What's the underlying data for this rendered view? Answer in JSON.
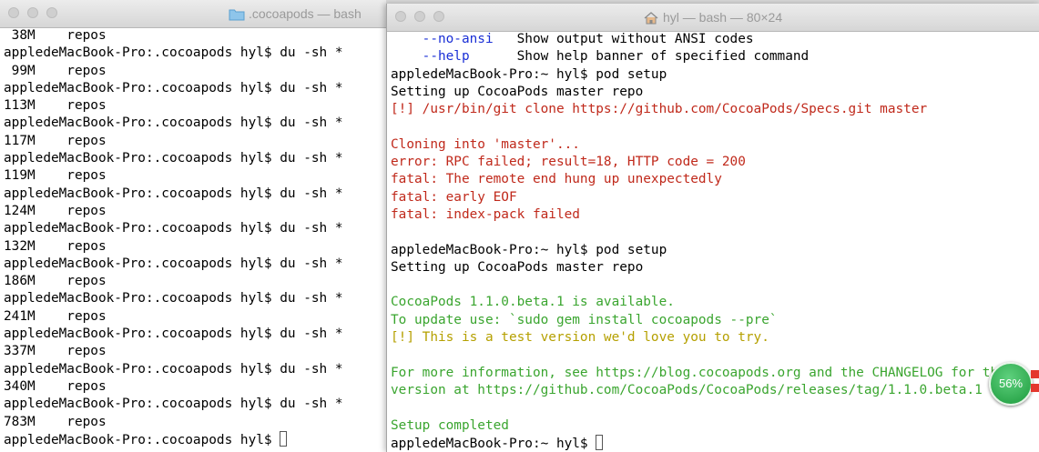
{
  "colors": {
    "default": "#000000",
    "option": "#1a2fd6",
    "error": "#c0291b",
    "success": "#3aa52f",
    "warning": "#b5a000"
  },
  "left_window": {
    "title": ".cocoapods — bash",
    "folder_icon": "folder-icon",
    "lines": [
      {
        "text": " 38M    repos",
        "color": "default"
      },
      {
        "text": "appledeMacBook-Pro:.cocoapods hyl$ du -sh *",
        "color": "default"
      },
      {
        "text": " 99M    repos",
        "color": "default"
      },
      {
        "text": "appledeMacBook-Pro:.cocoapods hyl$ du -sh *",
        "color": "default"
      },
      {
        "text": "113M    repos",
        "color": "default"
      },
      {
        "text": "appledeMacBook-Pro:.cocoapods hyl$ du -sh *",
        "color": "default"
      },
      {
        "text": "117M    repos",
        "color": "default"
      },
      {
        "text": "appledeMacBook-Pro:.cocoapods hyl$ du -sh *",
        "color": "default"
      },
      {
        "text": "119M    repos",
        "color": "default"
      },
      {
        "text": "appledeMacBook-Pro:.cocoapods hyl$ du -sh *",
        "color": "default"
      },
      {
        "text": "124M    repos",
        "color": "default"
      },
      {
        "text": "appledeMacBook-Pro:.cocoapods hyl$ du -sh *",
        "color": "default"
      },
      {
        "text": "132M    repos",
        "color": "default"
      },
      {
        "text": "appledeMacBook-Pro:.cocoapods hyl$ du -sh *",
        "color": "default"
      },
      {
        "text": "186M    repos",
        "color": "default"
      },
      {
        "text": "appledeMacBook-Pro:.cocoapods hyl$ du -sh *",
        "color": "default"
      },
      {
        "text": "241M    repos",
        "color": "default"
      },
      {
        "text": "appledeMacBook-Pro:.cocoapods hyl$ du -sh *",
        "color": "default"
      },
      {
        "text": "337M    repos",
        "color": "default"
      },
      {
        "text": "appledeMacBook-Pro:.cocoapods hyl$ du -sh *",
        "color": "default"
      },
      {
        "text": "340M    repos",
        "color": "default"
      },
      {
        "text": "appledeMacBook-Pro:.cocoapods hyl$ du -sh *",
        "color": "default"
      },
      {
        "text": "783M    repos",
        "color": "default"
      },
      {
        "text": "appledeMacBook-Pro:.cocoapods hyl$ ",
        "color": "default",
        "cursor": true
      }
    ]
  },
  "right_window": {
    "title": "hyl — bash — 80×24",
    "home_icon": "home-icon",
    "lines": [
      {
        "segments": [
          {
            "text": "    --no-ansi",
            "color": "option"
          },
          {
            "text": "   Show output without ANSI codes",
            "color": "default"
          }
        ]
      },
      {
        "segments": [
          {
            "text": "    --help",
            "color": "option"
          },
          {
            "text": "      Show help banner of specified command",
            "color": "default"
          }
        ]
      },
      {
        "segments": [
          {
            "text": "appledeMacBook-Pro:~ hyl$ pod setup",
            "color": "default"
          }
        ]
      },
      {
        "segments": [
          {
            "text": "Setting up CocoaPods master repo",
            "color": "default"
          }
        ]
      },
      {
        "segments": [
          {
            "text": "[!] /usr/bin/git clone https://github.com/CocoaPods/Specs.git master",
            "color": "error"
          }
        ]
      },
      {
        "segments": [
          {
            "text": "",
            "color": "default"
          }
        ]
      },
      {
        "segments": [
          {
            "text": "Cloning into 'master'...",
            "color": "error"
          }
        ]
      },
      {
        "segments": [
          {
            "text": "error: RPC failed; result=18, HTTP code = 200",
            "color": "error"
          }
        ]
      },
      {
        "segments": [
          {
            "text": "fatal: The remote end hung up unexpectedly",
            "color": "error"
          }
        ]
      },
      {
        "segments": [
          {
            "text": "fatal: early EOF",
            "color": "error"
          }
        ]
      },
      {
        "segments": [
          {
            "text": "fatal: index-pack failed",
            "color": "error"
          }
        ]
      },
      {
        "segments": [
          {
            "text": "",
            "color": "default"
          }
        ]
      },
      {
        "segments": [
          {
            "text": "appledeMacBook-Pro:~ hyl$ pod setup",
            "color": "default"
          }
        ]
      },
      {
        "segments": [
          {
            "text": "Setting up CocoaPods master repo",
            "color": "default"
          }
        ]
      },
      {
        "segments": [
          {
            "text": "",
            "color": "default"
          }
        ]
      },
      {
        "segments": [
          {
            "text": "CocoaPods 1.1.0.beta.1 is available.",
            "color": "success"
          }
        ]
      },
      {
        "segments": [
          {
            "text": "To update use: `sudo gem install cocoapods --pre`",
            "color": "success"
          }
        ]
      },
      {
        "segments": [
          {
            "text": "[!] This is a test version we'd love you to try.",
            "color": "warning"
          }
        ]
      },
      {
        "segments": [
          {
            "text": "",
            "color": "default"
          }
        ]
      },
      {
        "segments": [
          {
            "text": "For more information, see https://blog.cocoapods.org and the CHANGELOG for this",
            "color": "success"
          }
        ]
      },
      {
        "segments": [
          {
            "text": "version at https://github.com/CocoaPods/CocoaPods/releases/tag/1.1.0.beta.1",
            "color": "success"
          }
        ]
      },
      {
        "segments": [
          {
            "text": "",
            "color": "default"
          }
        ]
      },
      {
        "segments": [
          {
            "text": "Setup completed",
            "color": "success"
          }
        ]
      },
      {
        "segments": [
          {
            "text": "appledeMacBook-Pro:~ hyl$ ",
            "color": "default"
          }
        ],
        "cursor": true
      }
    ]
  },
  "overlay": {
    "percent_badge": "56%"
  }
}
